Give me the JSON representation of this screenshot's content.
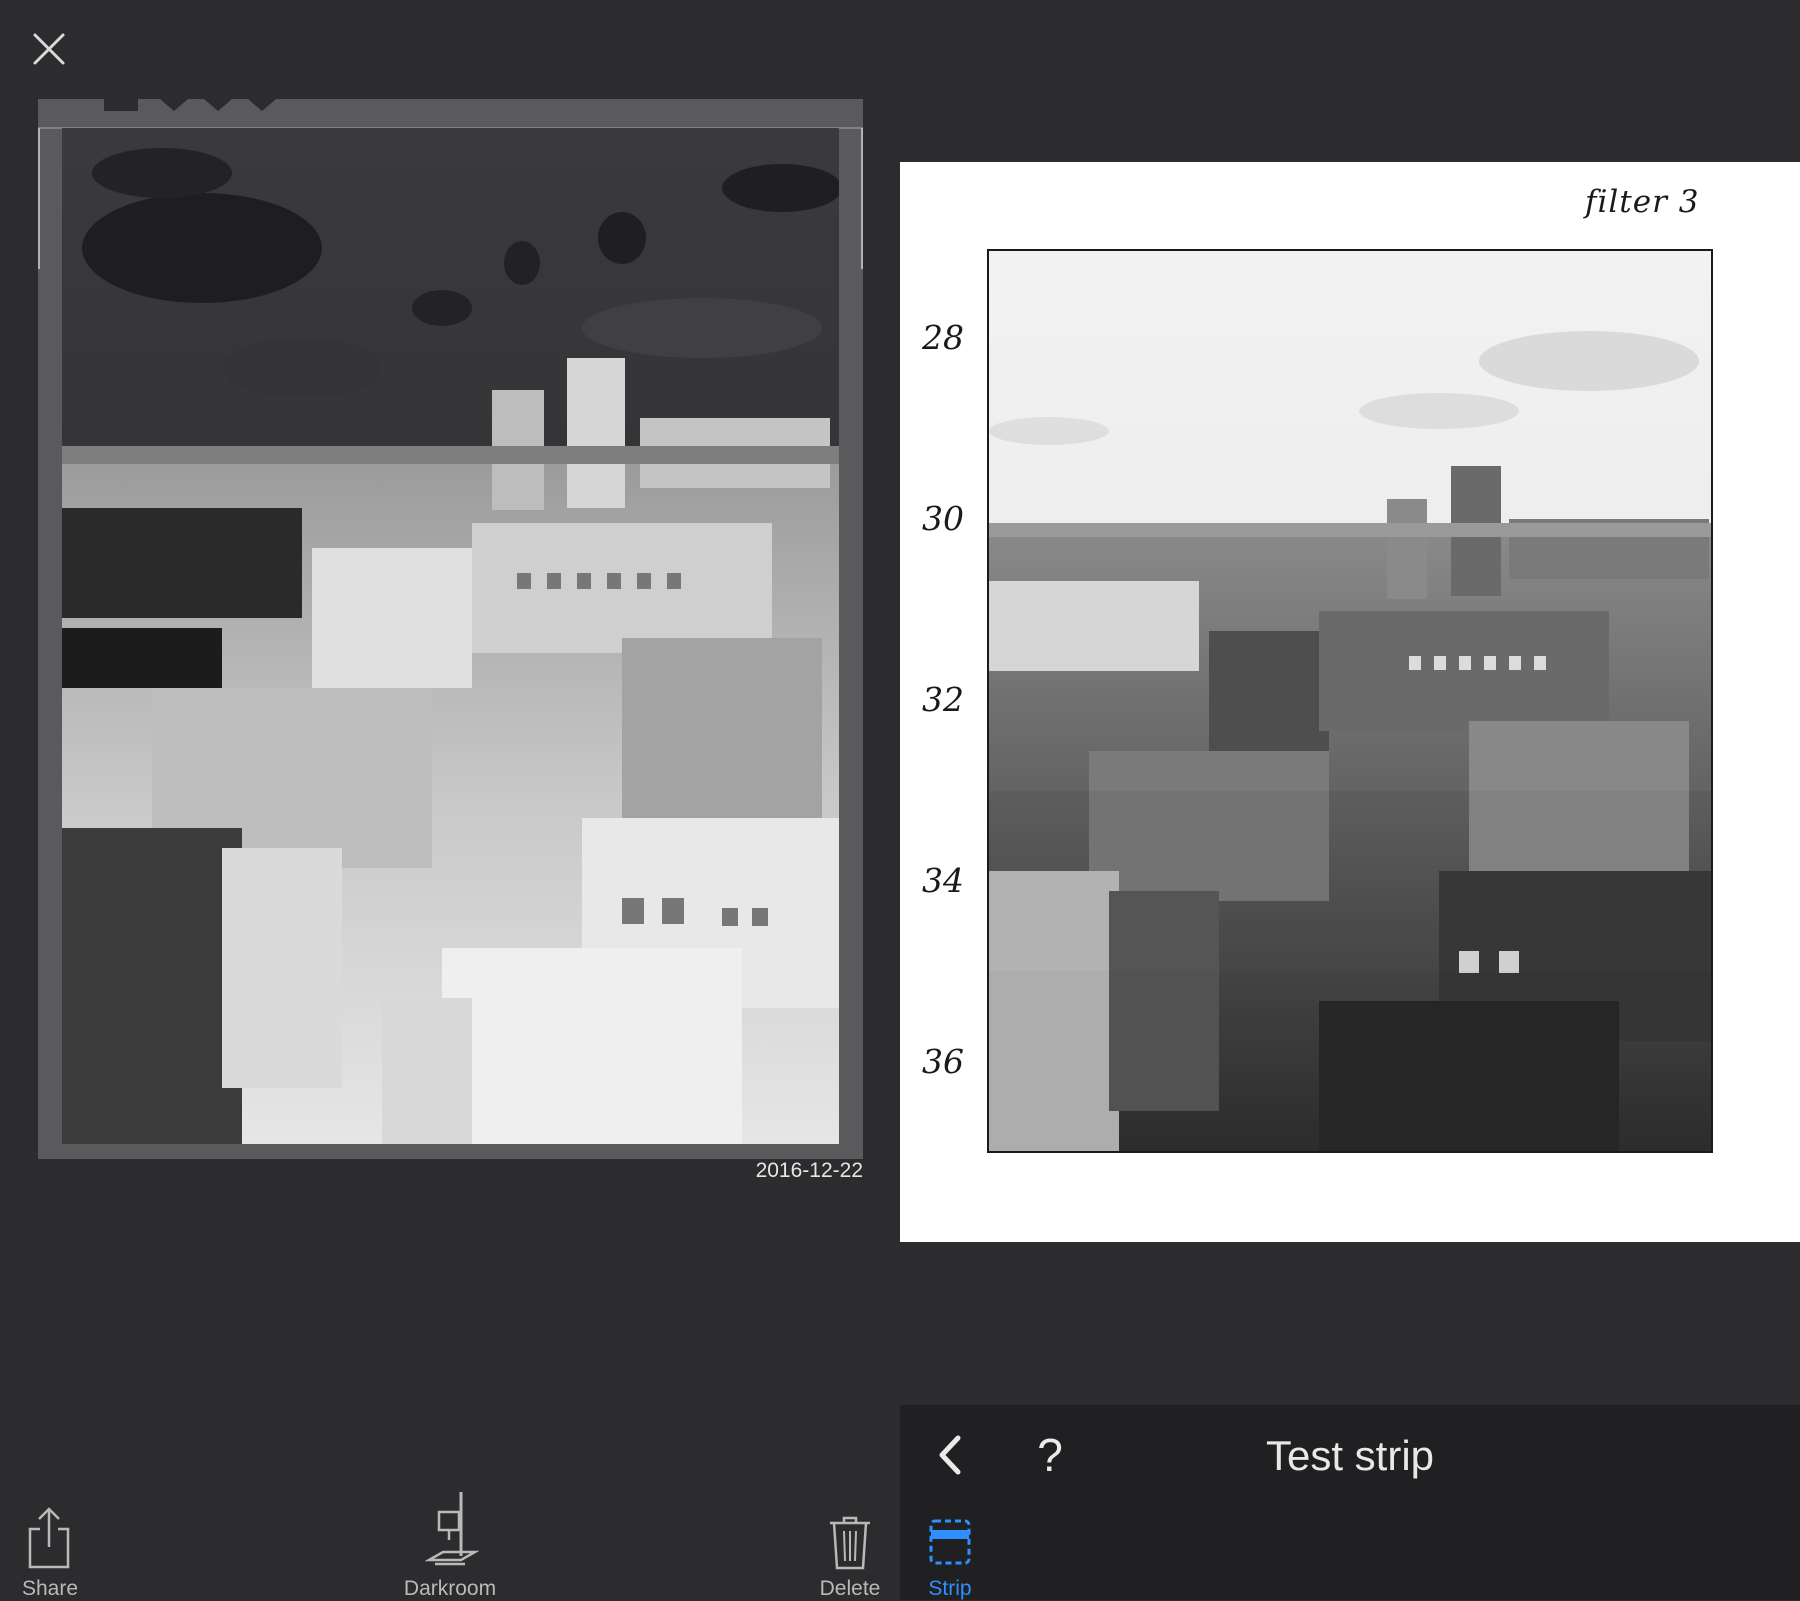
{
  "icons": {
    "close": "close-icon",
    "share": "share-icon",
    "darkroom": "enlarger-icon",
    "delete": "trash-icon",
    "strip": "strip-icon",
    "back": "chevron-left-icon",
    "help": "question-mark-icon"
  },
  "negative": {
    "date": "2016-12-22"
  },
  "print": {
    "filter_label": "filter 3",
    "strip_numbers": [
      "28",
      "30",
      "32",
      "34",
      "36"
    ]
  },
  "toolbar": {
    "help_label": "?",
    "title": "Test strip"
  },
  "tabs": {
    "share": "Share",
    "darkroom": "Darkroom",
    "delete": "Delete",
    "strip": "Strip"
  },
  "colors": {
    "background": "#2c2c2e",
    "toolbar": "#202022",
    "paper": "#ffffff",
    "active": "#2f8fff",
    "inactive": "#b9b9b9"
  }
}
